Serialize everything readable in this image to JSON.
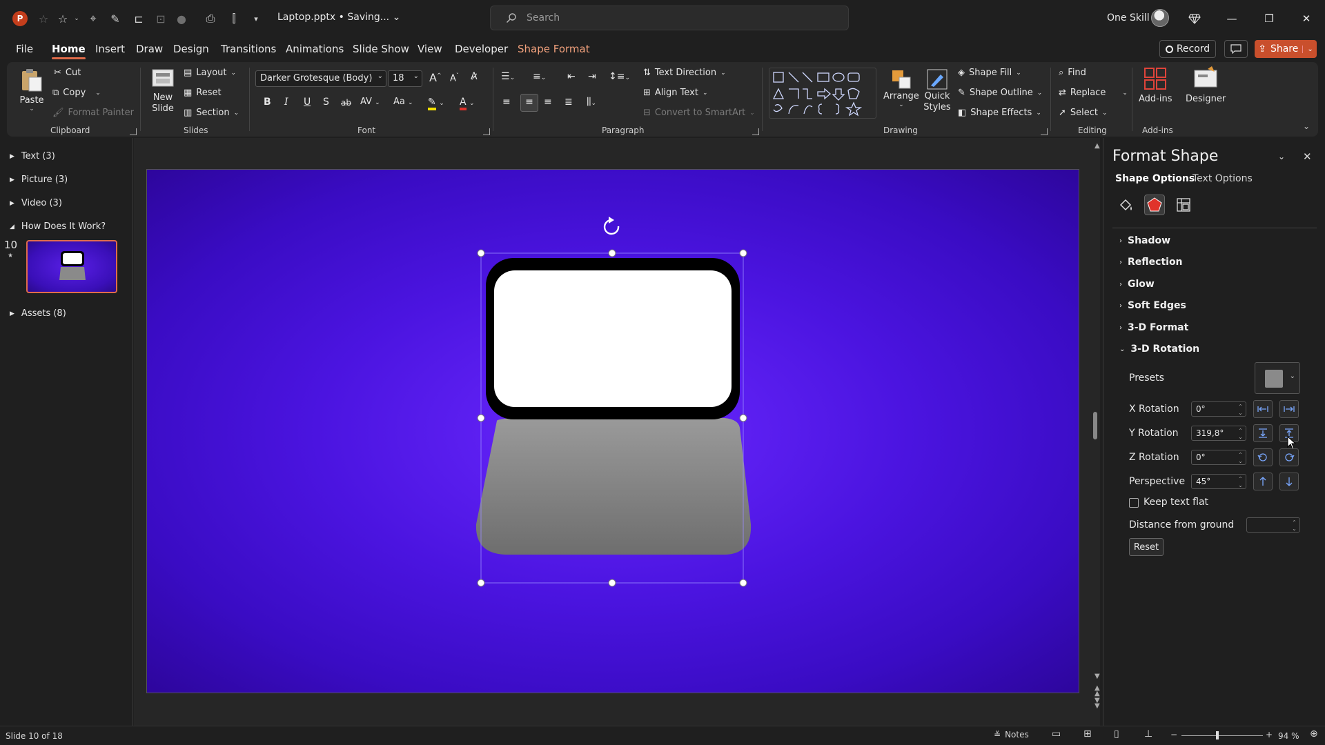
{
  "titlebar": {
    "doc_title": "Laptop.pptx • Saving...",
    "search_placeholder": "Search",
    "user_name": "One Skill"
  },
  "tabs": [
    "File",
    "Home",
    "Insert",
    "Draw",
    "Design",
    "Transitions",
    "Animations",
    "Slide Show",
    "View",
    "Developer",
    "Shape Format"
  ],
  "active_tab": "Home",
  "ribbon_right": {
    "record": "Record",
    "share": "Share"
  },
  "clipboard": {
    "paste": "Paste",
    "cut": "Cut",
    "copy": "Copy",
    "format_painter": "Format Painter",
    "label": "Clipboard"
  },
  "slides": {
    "new_slide": "New Slide",
    "layout": "Layout",
    "reset": "Reset",
    "section": "Section",
    "label": "Slides"
  },
  "font": {
    "family": "Darker Grotesque (Body)",
    "size": "18",
    "label": "Font",
    "bold": "B",
    "italic": "I",
    "underline": "U",
    "shadow": "S",
    "strike": "ab",
    "spacing": "AV",
    "case": "Aa",
    "color": "A"
  },
  "paragraph": {
    "text_direction": "Text Direction",
    "align_text": "Align Text",
    "convert_smartart": "Convert to SmartArt",
    "label": "Paragraph"
  },
  "drawing": {
    "arrange": "Arrange",
    "quick_styles": "Quick Styles",
    "shape_fill": "Shape Fill",
    "shape_outline": "Shape Outline",
    "shape_effects": "Shape Effects",
    "label": "Drawing"
  },
  "editing": {
    "find": "Find",
    "replace": "Replace",
    "select": "Select",
    "label": "Editing"
  },
  "addins": {
    "addins": "Add-ins",
    "designer": "Designer",
    "label": "Add-ins"
  },
  "outline": {
    "sections": [
      {
        "label": "Text (3)",
        "expanded": false
      },
      {
        "label": "Picture (3)",
        "expanded": false
      },
      {
        "label": "Video (3)",
        "expanded": false
      },
      {
        "label": "How Does It Work?",
        "expanded": true
      },
      {
        "label": "Assets (8)",
        "expanded": false
      }
    ],
    "slide_number": "10"
  },
  "format_pane": {
    "title": "Format Shape",
    "tab_shape": "Shape Options",
    "tab_text": "Text Options",
    "sections": [
      "Shadow",
      "Reflection",
      "Glow",
      "Soft Edges",
      "3-D Format",
      "3-D Rotation"
    ],
    "presets_label": "Presets",
    "x_rotation_label": "X Rotation",
    "x_rotation": "0°",
    "y_rotation_label": "Y Rotation",
    "y_rotation": "319,8°",
    "z_rotation_label": "Z Rotation",
    "z_rotation": "0°",
    "perspective_label": "Perspective",
    "perspective": "45°",
    "keep_text_flat": "Keep text flat",
    "distance_label": "Distance from ground",
    "reset": "Reset"
  },
  "statusbar": {
    "slide_info": "Slide 10 of 18",
    "notes": "Notes",
    "zoom": "94 %"
  },
  "colors": {
    "accent": "#e06c4a",
    "slide_bg": "#4b14e0",
    "laptop_screen_border": "#000000",
    "laptop_screen": "#ffffff",
    "laptop_base": "#8a8a8a"
  }
}
